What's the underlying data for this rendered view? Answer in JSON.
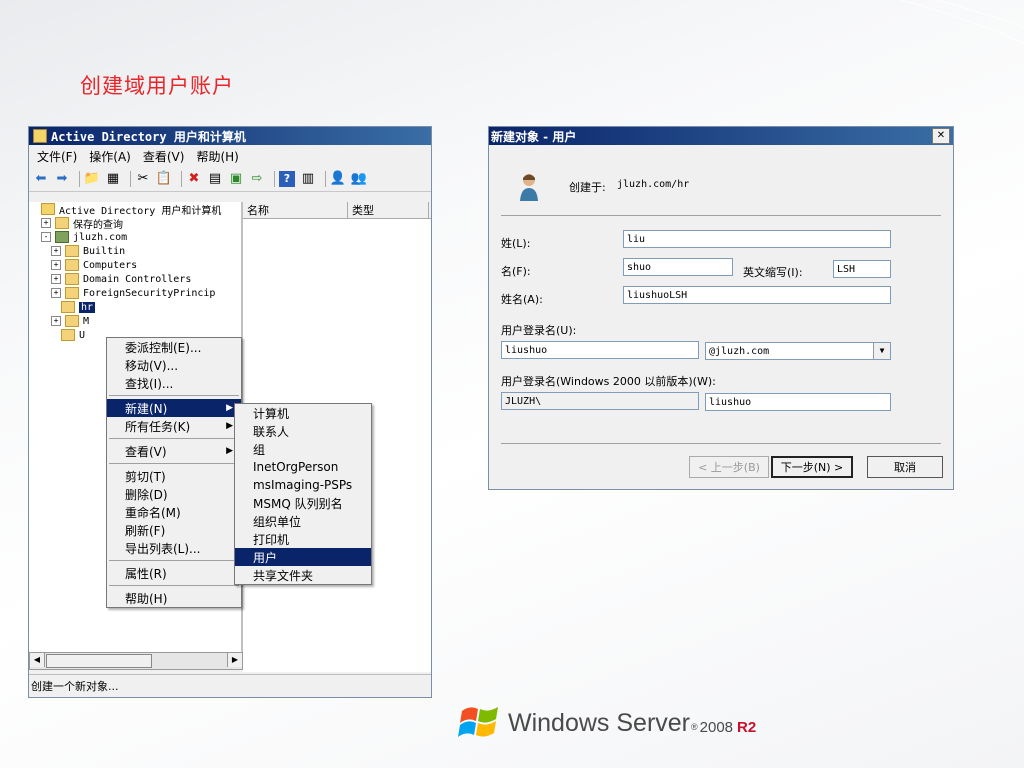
{
  "slide": {
    "title": "创建域用户账户"
  },
  "aduc": {
    "window_title": "Active Directory 用户和计算机",
    "menus": [
      "文件(F)",
      "操作(A)",
      "查看(V)",
      "帮助(H)"
    ],
    "tree": [
      {
        "label": "Active Directory 用户和计算机",
        "indent": 0,
        "expander": "",
        "icon": "snapin"
      },
      {
        "label": "保存的查询",
        "indent": 1,
        "expander": "+",
        "icon": "folder"
      },
      {
        "label": "jluzh.com",
        "indent": 1,
        "expander": "-",
        "icon": "domain"
      },
      {
        "label": "Builtin",
        "indent": 2,
        "expander": "+",
        "icon": "folder"
      },
      {
        "label": "Computers",
        "indent": 2,
        "expander": "+",
        "icon": "folder"
      },
      {
        "label": "Domain Controllers",
        "indent": 2,
        "expander": "+",
        "icon": "ou"
      },
      {
        "label": "ForeignSecurityPrincip",
        "indent": 2,
        "expander": "+",
        "icon": "folder"
      },
      {
        "label": "hr",
        "indent": 2,
        "expander": "",
        "icon": "ou"
      },
      {
        "label": "M",
        "indent": 2,
        "expander": "+",
        "icon": "folder"
      },
      {
        "label": "U",
        "indent": 2,
        "expander": "",
        "icon": "folder"
      }
    ],
    "columns": [
      "名称",
      "类型"
    ],
    "status": "创建一个新对象..."
  },
  "context_menu": {
    "items": [
      {
        "label": "委派控制(E)...",
        "submenu": false
      },
      {
        "label": "移动(V)...",
        "submenu": false
      },
      {
        "label": "查找(I)...",
        "submenu": false
      },
      {
        "sep": true
      },
      {
        "label": "新建(N)",
        "submenu": true,
        "selected": true
      },
      {
        "label": "所有任务(K)",
        "submenu": true
      },
      {
        "sep": true
      },
      {
        "label": "查看(V)",
        "submenu": true
      },
      {
        "sep": true
      },
      {
        "label": "剪切(T)",
        "submenu": false
      },
      {
        "label": "删除(D)",
        "submenu": false
      },
      {
        "label": "重命名(M)",
        "submenu": false
      },
      {
        "label": "刷新(F)",
        "submenu": false
      },
      {
        "label": "导出列表(L)...",
        "submenu": false
      },
      {
        "sep": true
      },
      {
        "label": "属性(R)",
        "submenu": false
      },
      {
        "sep": true
      },
      {
        "label": "帮助(H)",
        "submenu": false
      }
    ]
  },
  "submenu": {
    "items": [
      {
        "label": "计算机"
      },
      {
        "label": "联系人"
      },
      {
        "label": "组"
      },
      {
        "label": "InetOrgPerson"
      },
      {
        "label": "msImaging-PSPs"
      },
      {
        "label": "MSMQ 队列别名"
      },
      {
        "label": "组织单位"
      },
      {
        "label": "打印机"
      },
      {
        "label": "用户",
        "selected": true
      },
      {
        "label": "共享文件夹"
      }
    ]
  },
  "dialog": {
    "title": "新建对象 - 用户",
    "created_in_label": "创建于:",
    "created_in_value": "jluzh.com/hr",
    "last_name_label": "姓(L):",
    "last_name_value": "liu",
    "first_name_label": "名(F):",
    "first_name_value": "shuo",
    "initials_label": "英文缩写(I):",
    "initials_value": "LSH",
    "full_name_label": "姓名(A):",
    "full_name_value": "liushuoLSH",
    "logon_label": "用户登录名(U):",
    "logon_value": "liushuo",
    "upn_suffix": "@jluzh.com",
    "pre2000_label": "用户登录名(Windows 2000 以前版本)(W):",
    "pre2000_domain": "JLUZH\\",
    "pre2000_value": "liushuo",
    "back_button": "< 上一步(B)",
    "next_button": "下一步(N) >",
    "cancel_button": "取消"
  },
  "logo": {
    "brand": "Windows Server",
    "version": "2008",
    "edition": "R2"
  },
  "colors": {
    "title_red": "#e8262a",
    "selection": "#0a246a",
    "r2_red": "#c8102e"
  }
}
